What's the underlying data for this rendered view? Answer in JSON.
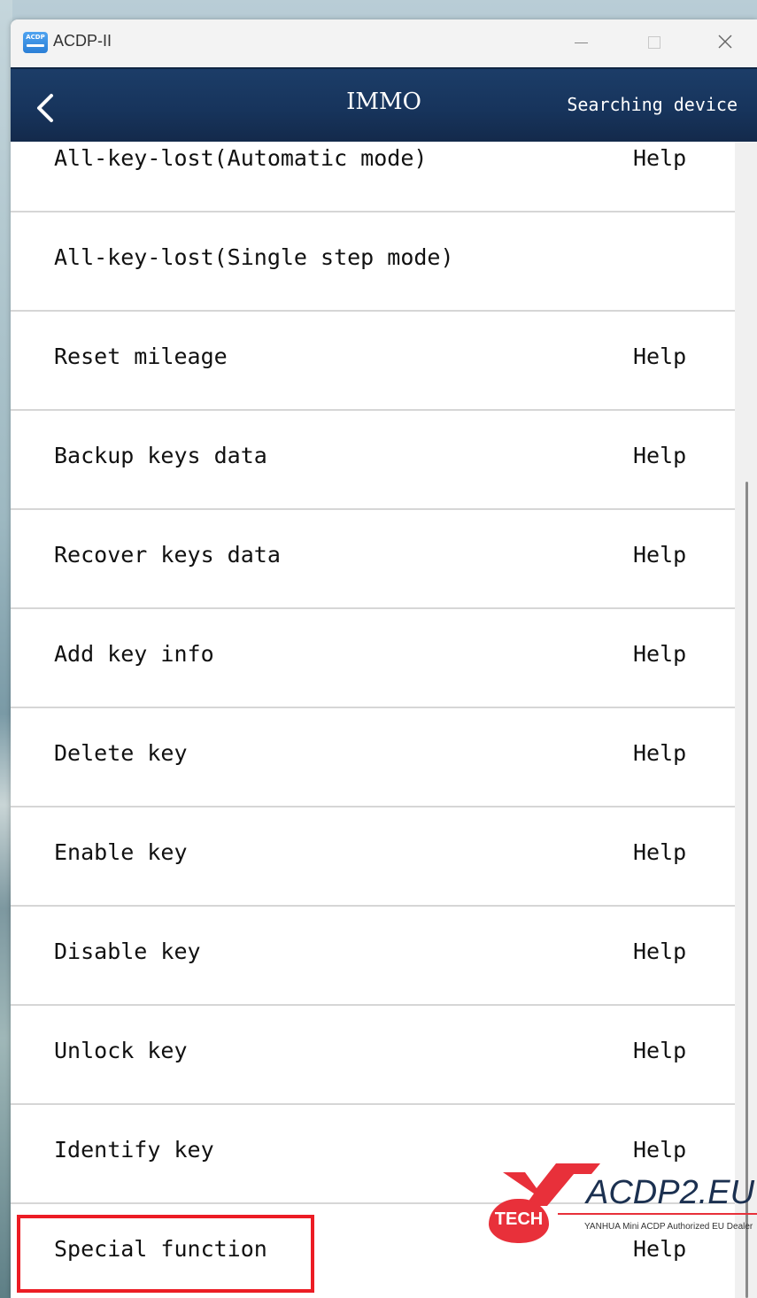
{
  "window": {
    "app_title": "ACDP-II",
    "icon_text": "ACDP"
  },
  "header": {
    "title": "IMMO",
    "status": "Searching device"
  },
  "menu_items": [
    {
      "label": "All-key-lost(Automatic mode)",
      "help": "Help"
    },
    {
      "label": "All-key-lost(Single step mode)",
      "help": ""
    },
    {
      "label": "Reset mileage",
      "help": "Help"
    },
    {
      "label": "Backup keys data",
      "help": "Help"
    },
    {
      "label": "Recover keys data",
      "help": "Help"
    },
    {
      "label": "Add key info",
      "help": "Help"
    },
    {
      "label": "Delete key",
      "help": "Help"
    },
    {
      "label": "Enable key",
      "help": "Help"
    },
    {
      "label": "Disable key",
      "help": "Help"
    },
    {
      "label": "Unlock key",
      "help": "Help"
    },
    {
      "label": "Identify key",
      "help": "Help"
    },
    {
      "label": "Special function",
      "help": "Help"
    }
  ],
  "watermark": {
    "tech": "TECH",
    "domain": "ACDP2.EU",
    "tagline": "YANHUA Mini ACDP Authorized EU Dealer"
  },
  "colors": {
    "header_bg": "#17345c",
    "highlight": "#ec1c24",
    "watermark_red": "#e8303a"
  }
}
